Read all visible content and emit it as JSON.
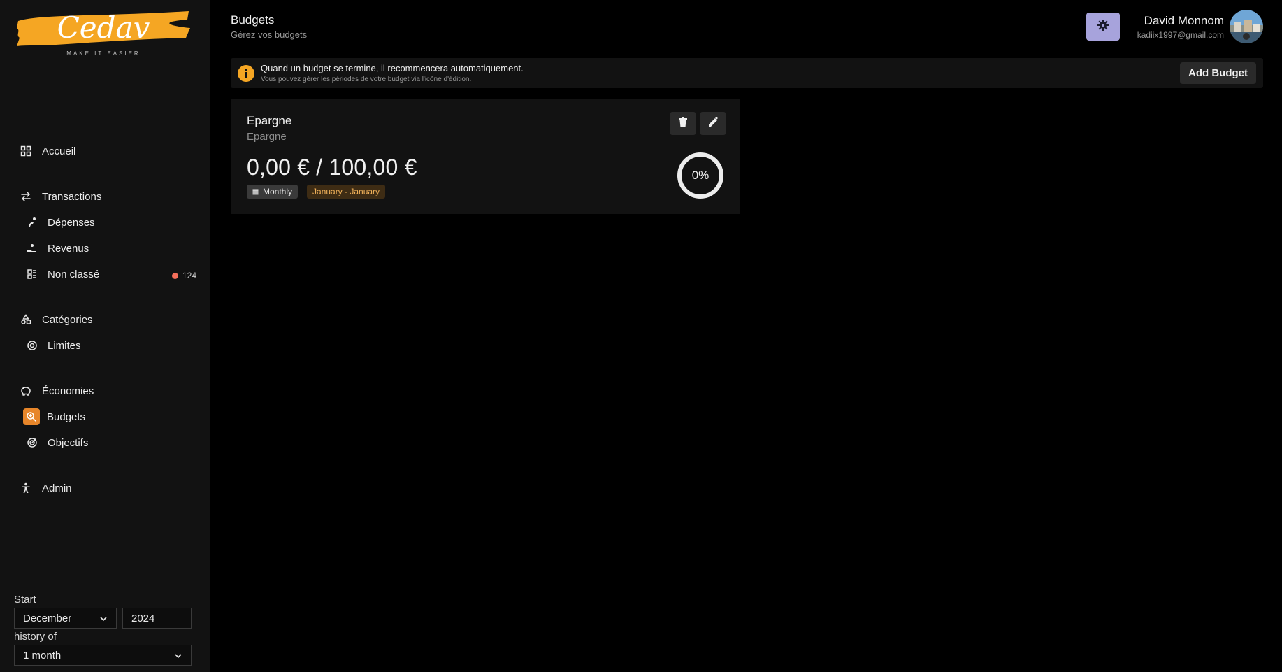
{
  "brand": {
    "logo_text": "Cedav",
    "tagline": "MAKE IT EASIER",
    "accent": "#f5a623"
  },
  "sidebar": {
    "items": [
      {
        "label": "Accueil",
        "icon": "grid-icon"
      },
      {
        "label": "Transactions",
        "icon": "arrows-swap-icon"
      },
      {
        "label": "Dépenses",
        "icon": "hand-coins-icon"
      },
      {
        "label": "Revenus",
        "icon": "hand-receive-icon"
      },
      {
        "label": "Non classé",
        "icon": "unsorted-icon",
        "badge": "124",
        "badge_color": "#f56f5b"
      },
      {
        "label": "Catégories",
        "icon": "shapes-icon"
      },
      {
        "label": "Limites",
        "icon": "target-icon"
      },
      {
        "label": "Économies",
        "icon": "piggy-bank-icon"
      },
      {
        "label": "Budgets",
        "icon": "budget-search-icon",
        "active": true
      },
      {
        "label": "Objectifs",
        "icon": "goal-icon"
      },
      {
        "label": "Admin",
        "icon": "person-icon"
      }
    ],
    "filters": {
      "start_label": "Start",
      "month": "December",
      "year": "2024",
      "history_label": "history of",
      "history": "1 month"
    }
  },
  "header": {
    "title": "Budgets",
    "subtitle": "Gérez vos budgets",
    "settings_color": "#a7a3dc",
    "user_name": "David Monnom",
    "user_email": "kadiix1997@gmail.com"
  },
  "banner": {
    "text": "Quand un budget se termine, il recommencera automatiquement.",
    "subtext": "Vous pouvez gérer les périodes de votre budget via l'icône d'édition.",
    "add_button": "Add Budget",
    "icon_color": "#f5a623"
  },
  "budget_card": {
    "title": "Epargne",
    "category": "Epargne",
    "amount": "0,00 € / 100,00 €",
    "period": "Monthly",
    "range": "January - January",
    "progress_label": "0%",
    "progress": 0
  }
}
